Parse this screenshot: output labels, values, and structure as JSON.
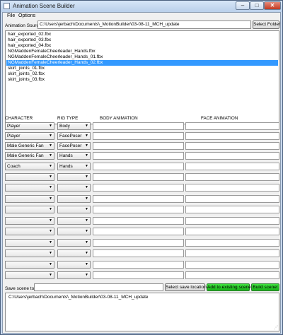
{
  "window": {
    "title": "Animation Scene Builder",
    "minimize": "–",
    "maximize": "□",
    "close": "✕"
  },
  "menu": [
    "File",
    "Options"
  ],
  "source": {
    "label": "Animation Source:",
    "value": "C:\\Users\\jerbach\\Documents\\_MotionBuilder\\03-08-11_MCH_update",
    "button": "Select Folder"
  },
  "files": [
    "hair_exported_02.fbx",
    "hair_exported_03.fbx",
    "hair_exported_04.fbx",
    "NGMaddenFemaleCheerleader_Hands.fbx",
    "NGMaddenFemaleCheerleader_Hands_01.fbx",
    "NGMaddenFemaleCheerleader_Hands_02.fbx",
    "skirt_joints_01.fbx",
    "skirt_joints_02.fbx",
    "skirt_joints_03.fbx"
  ],
  "selected_file_index": 5,
  "headers": {
    "character": "CHARACTER",
    "rig_type": "RIG TYPE",
    "body": "BODY ANIMATION",
    "face": "FACE ANIMATION"
  },
  "rows": [
    {
      "character": "Player",
      "rig": "Body"
    },
    {
      "character": "Player",
      "rig": "FacePoser"
    },
    {
      "character": "Male Generic Fan",
      "rig": "FacePoser"
    },
    {
      "character": "Male Generic Fan",
      "rig": "Hands"
    },
    {
      "character": "Coach",
      "rig": "Hands"
    },
    {
      "character": "",
      "rig": ""
    },
    {
      "character": "",
      "rig": ""
    },
    {
      "character": "",
      "rig": ""
    },
    {
      "character": "",
      "rig": ""
    },
    {
      "character": "",
      "rig": ""
    },
    {
      "character": "",
      "rig": ""
    },
    {
      "character": "",
      "rig": ""
    },
    {
      "character": "",
      "rig": ""
    },
    {
      "character": "",
      "rig": ""
    },
    {
      "character": "",
      "rig": ""
    }
  ],
  "save": {
    "label": "Save scene to:",
    "select_button": "Select save location",
    "add_button": "Add to existing scene",
    "build_button": "Build scene!"
  },
  "output": {
    "text": "C:\\Users\\jerbach\\Documents\\_MotionBuilder\\03-08-11_MCH_update"
  }
}
